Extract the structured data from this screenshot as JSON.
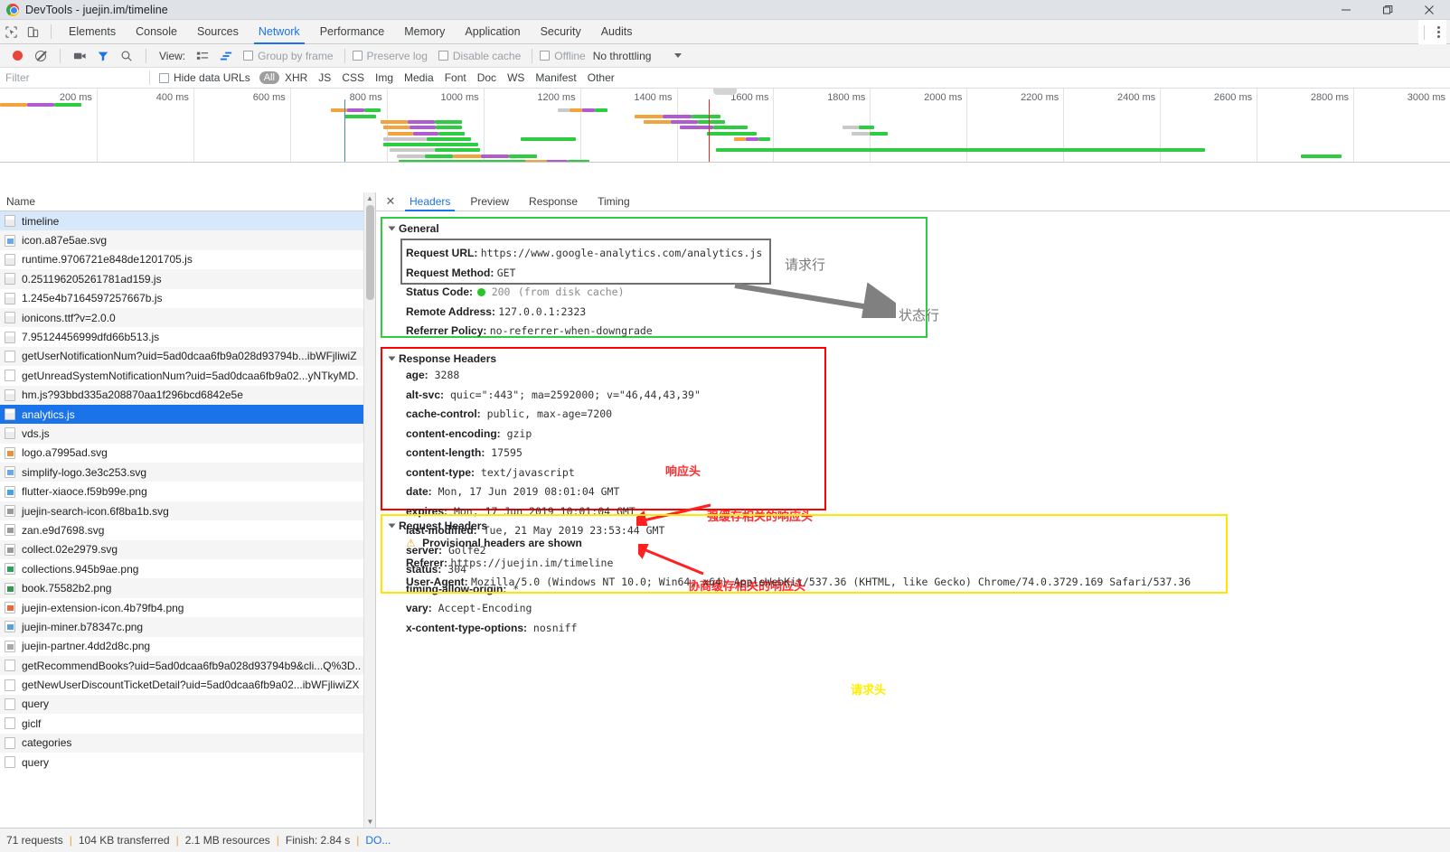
{
  "window": {
    "title": "DevTools - juejin.im/timeline",
    "minimize_label": "─",
    "maximize_label": "❐",
    "close_label": "✕"
  },
  "main_tabs": {
    "items": [
      {
        "label": "Elements",
        "active": false
      },
      {
        "label": "Console",
        "active": false
      },
      {
        "label": "Sources",
        "active": false
      },
      {
        "label": "Network",
        "active": true
      },
      {
        "label": "Performance",
        "active": false
      },
      {
        "label": "Memory",
        "active": false
      },
      {
        "label": "Application",
        "active": false
      },
      {
        "label": "Security",
        "active": false
      },
      {
        "label": "Audits",
        "active": false
      }
    ]
  },
  "network_toolbar": {
    "view_label": "View:",
    "group_by_frame": "Group by frame",
    "preserve_log": "Preserve log",
    "disable_cache": "Disable cache",
    "offline": "Offline",
    "throttling": "No throttling"
  },
  "filter_bar": {
    "placeholder": "Filter",
    "value": "",
    "hide_data_urls": "Hide data URLs",
    "types": [
      {
        "label": "All",
        "active": true
      },
      {
        "label": "XHR",
        "active": false
      },
      {
        "label": "JS",
        "active": false
      },
      {
        "label": "CSS",
        "active": false
      },
      {
        "label": "Img",
        "active": false
      },
      {
        "label": "Media",
        "active": false
      },
      {
        "label": "Font",
        "active": false
      },
      {
        "label": "Doc",
        "active": false
      },
      {
        "label": "WS",
        "active": false
      },
      {
        "label": "Manifest",
        "active": false
      },
      {
        "label": "Other",
        "active": false
      }
    ]
  },
  "overview": {
    "ticks": [
      "200 ms",
      "400 ms",
      "600 ms",
      "800 ms",
      "1000 ms",
      "1200 ms",
      "1400 ms",
      "1600 ms",
      "1800 ms",
      "2000 ms",
      "2200 ms",
      "2400 ms",
      "2600 ms",
      "2800 ms",
      "3000 ms"
    ]
  },
  "requests_panel": {
    "column_header": "Name",
    "rows": [
      {
        "name": "timeline",
        "icon": "document-icon",
        "state": "highlighted"
      },
      {
        "name": "icon.a87e5ae.svg",
        "icon": "image-icon",
        "state": "normal"
      },
      {
        "name": "runtime.9706721e848de1201705.js",
        "icon": "script-icon",
        "state": "normal"
      },
      {
        "name": "0.251196205261781ad159.js",
        "icon": "script-icon",
        "state": "normal"
      },
      {
        "name": "1.245e4b7164597257667b.js",
        "icon": "script-icon",
        "state": "normal"
      },
      {
        "name": "ionicons.ttf?v=2.0.0",
        "icon": "font-icon",
        "state": "normal"
      },
      {
        "name": "7.95124456999dfd66b513.js",
        "icon": "script-icon",
        "state": "normal"
      },
      {
        "name": "getUserNotificationNum?uid=5ad0dcaa6fb9a028d93794b...ibWFjliwiZ",
        "icon": "xhr-icon",
        "state": "normal"
      },
      {
        "name": "getUnreadSystemNotificationNum?uid=5ad0dcaa6fb9a02...yNTkyMD.",
        "icon": "xhr-icon",
        "state": "normal"
      },
      {
        "name": "hm.js?93bbd335a208870aa1f296bcd6842e5e",
        "icon": "script-icon",
        "state": "normal"
      },
      {
        "name": "analytics.js",
        "icon": "script-icon",
        "state": "selected"
      },
      {
        "name": "vds.js",
        "icon": "script-icon",
        "state": "normal"
      },
      {
        "name": "logo.a7995ad.svg",
        "icon": "image-icon",
        "state": "normal"
      },
      {
        "name": "simplify-logo.3e3c253.svg",
        "icon": "image-icon",
        "state": "normal"
      },
      {
        "name": "flutter-xiaoce.f59b99e.png",
        "icon": "image-icon",
        "state": "normal"
      },
      {
        "name": "juejin-search-icon.6f8ba1b.svg",
        "icon": "image-icon",
        "state": "normal"
      },
      {
        "name": "zan.e9d7698.svg",
        "icon": "image-icon",
        "state": "normal"
      },
      {
        "name": "collect.02e2979.svg",
        "icon": "image-icon",
        "state": "normal"
      },
      {
        "name": "collections.945b9ae.png",
        "icon": "image-icon",
        "state": "normal"
      },
      {
        "name": "book.75582b2.png",
        "icon": "image-icon",
        "state": "normal"
      },
      {
        "name": "juejin-extension-icon.4b79fb4.png",
        "icon": "image-icon",
        "state": "normal"
      },
      {
        "name": "juejin-miner.b78347c.png",
        "icon": "image-icon",
        "state": "normal"
      },
      {
        "name": "juejin-partner.4dd2d8c.png",
        "icon": "image-icon",
        "state": "normal"
      },
      {
        "name": "getRecommendBooks?uid=5ad0dcaa6fb9a028d93794b9&cli...Q%3D..",
        "icon": "xhr-icon",
        "state": "normal"
      },
      {
        "name": "getNewUserDiscountTicketDetail?uid=5ad0dcaa6fb9a02...ibWFjliwiZX",
        "icon": "xhr-icon",
        "state": "normal"
      },
      {
        "name": "query",
        "icon": "xhr-icon",
        "state": "normal"
      },
      {
        "name": "giclf",
        "icon": "xhr-icon",
        "state": "normal"
      },
      {
        "name": "categories",
        "icon": "xhr-icon",
        "state": "normal"
      },
      {
        "name": "query",
        "icon": "xhr-icon",
        "state": "normal"
      }
    ]
  },
  "detail_tabs": {
    "close_label": "✕",
    "items": [
      {
        "label": "Headers",
        "active": true
      },
      {
        "label": "Preview",
        "active": false
      },
      {
        "label": "Response",
        "active": false
      },
      {
        "label": "Timing",
        "active": false
      }
    ]
  },
  "general": {
    "section_title": "General",
    "rows": [
      {
        "key": "Request URL:",
        "value": "https://www.google-analytics.com/analytics.js"
      },
      {
        "key": "Request Method:",
        "value": "GET"
      },
      {
        "key": "Status Code:",
        "value": "200",
        "suffix": "(from disk cache)",
        "dot": true
      },
      {
        "key": "Remote Address:",
        "value": "127.0.0.1:2323"
      },
      {
        "key": "Referrer Policy:",
        "value": "no-referrer-when-downgrade"
      }
    ]
  },
  "response_headers": {
    "section_title": "Response Headers",
    "rows": [
      {
        "key": "age:",
        "value": "3288"
      },
      {
        "key": "alt-svc:",
        "value": "quic=\":443\"; ma=2592000; v=\"46,44,43,39\""
      },
      {
        "key": "cache-control:",
        "value": "public, max-age=7200"
      },
      {
        "key": "content-encoding:",
        "value": "gzip"
      },
      {
        "key": "content-length:",
        "value": "17595"
      },
      {
        "key": "content-type:",
        "value": "text/javascript"
      },
      {
        "key": "date:",
        "value": "Mon, 17 Jun 2019 08:01:04 GMT"
      },
      {
        "key": "expires:",
        "value": "Mon, 17 Jun 2019 10:01:04 GMT"
      },
      {
        "key": "last-modified:",
        "value": "Tue, 21 May 2019 23:53:44 GMT"
      },
      {
        "key": "server:",
        "value": "Golfe2"
      },
      {
        "key": "status:",
        "value": "304"
      },
      {
        "key": "timing-allow-origin:",
        "value": "*"
      },
      {
        "key": "vary:",
        "value": "Accept-Encoding"
      },
      {
        "key": "x-content-type-options:",
        "value": "nosniff"
      }
    ]
  },
  "request_headers": {
    "section_title": "Request Headers",
    "provisional": "Provisional headers are shown",
    "rows": [
      {
        "key": "Referer:",
        "value": "https://juejin.im/timeline"
      },
      {
        "key": "User-Agent:",
        "value": "Mozilla/5.0 (Windows NT 10.0; Win64; x64) AppleWebKit/537.36 (KHTML, like Gecko) Chrome/74.0.3729.169 Safari/537.36"
      }
    ]
  },
  "annotations": {
    "request_line": "请求行",
    "status_line": "状态行",
    "response_head": "响应头",
    "strong_cache": "强缓存相关的响应头",
    "negotiate_cache": "协商缓存相关的响应头",
    "request_head": "请求头"
  },
  "statusbar": {
    "requests": "71 requests",
    "transferred": "104 KB transferred",
    "resources": "2.1 MB resources",
    "finish": "Finish: 2.84 s",
    "dom": "DO...",
    "sep": "|"
  },
  "colors": {
    "accent": "#1a73e8",
    "green_box": "#2ecc40",
    "red_box": "#ff0000",
    "yellow_box": "#ffe600",
    "grey_box": "#707070",
    "record_red": "#e8453c"
  }
}
